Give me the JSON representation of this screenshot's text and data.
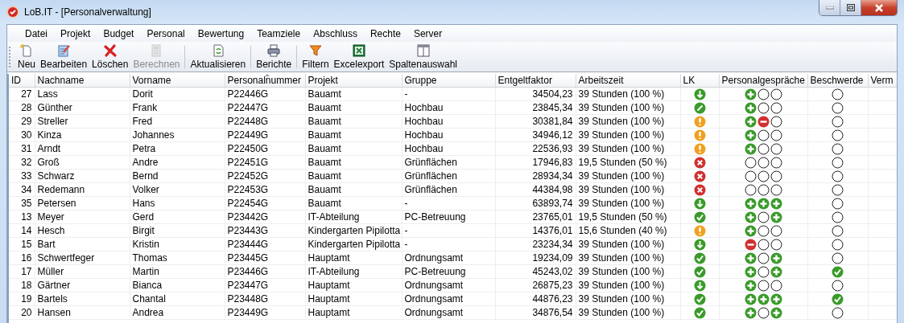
{
  "window": {
    "title": "LoB.IT - [Personalverwaltung]"
  },
  "menu": [
    "Datei",
    "Projekt",
    "Budget",
    "Personal",
    "Bewertung",
    "Teamziele",
    "Abschluss",
    "Rechte",
    "Server"
  ],
  "toolbar": [
    {
      "label": "Neu",
      "kind": "new",
      "disabled": false
    },
    {
      "label": "Bearbeiten",
      "kind": "edit",
      "disabled": false
    },
    {
      "label": "Löschen",
      "kind": "delete",
      "disabled": false
    },
    {
      "label": "Berechnen",
      "kind": "calc",
      "disabled": true
    },
    {
      "label": "Aktualisieren",
      "kind": "refresh",
      "disabled": false
    },
    {
      "label": "Berichte",
      "kind": "print",
      "disabled": false
    },
    {
      "label": "Filtern",
      "kind": "filter",
      "disabled": false
    },
    {
      "label": "Excelexport",
      "kind": "excel",
      "disabled": false
    },
    {
      "label": "Spaltenauswahl",
      "kind": "columns",
      "disabled": false
    }
  ],
  "table": {
    "columns": [
      {
        "label": "ID",
        "sorted": false
      },
      {
        "label": "Nachname",
        "sorted": false
      },
      {
        "label": "Vorname",
        "sorted": false
      },
      {
        "label": "Personalnummer",
        "sorted": true
      },
      {
        "label": "Projekt",
        "sorted": false
      },
      {
        "label": "Gruppe",
        "sorted": false
      },
      {
        "label": "Entgeltfaktor",
        "sorted": false
      },
      {
        "label": "Arbeitszeit",
        "sorted": false
      },
      {
        "label": "LK",
        "sorted": false
      },
      {
        "label": "Personalgespräche",
        "sorted": false
      },
      {
        "label": "Beschwerde",
        "sorted": false
      },
      {
        "label": "Verm",
        "sorted": false
      }
    ],
    "rows": [
      {
        "id": "27",
        "nachname": "Lass",
        "vorname": "Dorit",
        "personalnummer": "P22446G",
        "projekt": "Bauamt",
        "gruppe": "-",
        "entgeltfaktor": "34504,23",
        "arbeitszeit": "39 Stunden (100 %)",
        "lk": {
          "kind": "down"
        },
        "gespraeche": [
          {
            "kind": "plus"
          },
          {
            "kind": "empty"
          },
          {
            "kind": "empty"
          }
        ],
        "beschwerde": {
          "kind": "empty"
        }
      },
      {
        "id": "28",
        "nachname": "Günther",
        "vorname": "Frank",
        "personalnummer": "P22447G",
        "projekt": "Bauamt",
        "gruppe": "Hochbau",
        "entgeltfaktor": "23845,34",
        "arbeitszeit": "39 Stunden (100 %)",
        "lk": {
          "kind": "pencil"
        },
        "gespraeche": [
          {
            "kind": "plus"
          },
          {
            "kind": "empty"
          },
          {
            "kind": "empty"
          }
        ],
        "beschwerde": {
          "kind": "empty"
        }
      },
      {
        "id": "29",
        "nachname": "Streller",
        "vorname": "Fred",
        "personalnummer": "P22448G",
        "projekt": "Bauamt",
        "gruppe": "Hochbau",
        "entgeltfaktor": "30381,84",
        "arbeitszeit": "39 Stunden (100 %)",
        "lk": {
          "kind": "warn"
        },
        "gespraeche": [
          {
            "kind": "plus"
          },
          {
            "kind": "minus"
          },
          {
            "kind": "empty"
          }
        ],
        "beschwerde": {
          "kind": "empty"
        }
      },
      {
        "id": "30",
        "nachname": "Kinza",
        "vorname": "Johannes",
        "personalnummer": "P22449G",
        "projekt": "Bauamt",
        "gruppe": "Hochbau",
        "entgeltfaktor": "34946,12",
        "arbeitszeit": "39 Stunden (100 %)",
        "lk": {
          "kind": "warn"
        },
        "gespraeche": [
          {
            "kind": "plus"
          },
          {
            "kind": "empty"
          },
          {
            "kind": "empty"
          }
        ],
        "beschwerde": {
          "kind": "empty"
        }
      },
      {
        "id": "31",
        "nachname": "Arndt",
        "vorname": "Petra",
        "personalnummer": "P22450G",
        "projekt": "Bauamt",
        "gruppe": "Hochbau",
        "entgeltfaktor": "22536,93",
        "arbeitszeit": "39 Stunden (100 %)",
        "lk": {
          "kind": "warn"
        },
        "gespraeche": [
          {
            "kind": "plus"
          },
          {
            "kind": "empty"
          },
          {
            "kind": "empty"
          }
        ],
        "beschwerde": {
          "kind": "empty"
        }
      },
      {
        "id": "32",
        "nachname": "Groß",
        "vorname": "Andre",
        "personalnummer": "P22451G",
        "projekt": "Bauamt",
        "gruppe": "Grünflächen",
        "entgeltfaktor": "17946,83",
        "arbeitszeit": "19,5 Stunden (50 %)",
        "lk": {
          "kind": "error"
        },
        "gespraeche": [
          {
            "kind": "empty"
          },
          {
            "kind": "empty"
          },
          {
            "kind": "empty"
          }
        ],
        "beschwerde": {
          "kind": "empty"
        }
      },
      {
        "id": "33",
        "nachname": "Schwarz",
        "vorname": "Bernd",
        "personalnummer": "P22452G",
        "projekt": "Bauamt",
        "gruppe": "Grünflächen",
        "entgeltfaktor": "28934,34",
        "arbeitszeit": "39 Stunden (100 %)",
        "lk": {
          "kind": "error"
        },
        "gespraeche": [
          {
            "kind": "empty"
          },
          {
            "kind": "empty"
          },
          {
            "kind": "empty"
          }
        ],
        "beschwerde": {
          "kind": "empty"
        }
      },
      {
        "id": "34",
        "nachname": "Redemann",
        "vorname": "Volker",
        "personalnummer": "P22453G",
        "projekt": "Bauamt",
        "gruppe": "Grünflächen",
        "entgeltfaktor": "44384,98",
        "arbeitszeit": "39 Stunden (100 %)",
        "lk": {
          "kind": "error"
        },
        "gespraeche": [
          {
            "kind": "empty"
          },
          {
            "kind": "empty"
          },
          {
            "kind": "empty"
          }
        ],
        "beschwerde": {
          "kind": "empty"
        }
      },
      {
        "id": "35",
        "nachname": "Petersen",
        "vorname": "Hans",
        "personalnummer": "P22454G",
        "projekt": "Bauamt",
        "gruppe": "-",
        "entgeltfaktor": "63893,74",
        "arbeitszeit": "39 Stunden (100 %)",
        "lk": {
          "kind": "down"
        },
        "gespraeche": [
          {
            "kind": "plus"
          },
          {
            "kind": "plus"
          },
          {
            "kind": "plus"
          }
        ],
        "beschwerde": {
          "kind": "empty"
        }
      },
      {
        "id": "13",
        "nachname": "Meyer",
        "vorname": "Gerd",
        "personalnummer": "P23442G",
        "projekt": "IT-Abteilung",
        "gruppe": "PC-Betreuung",
        "entgeltfaktor": "23765,01",
        "arbeitszeit": "19,5 Stunden (50 %)",
        "lk": {
          "kind": "check"
        },
        "gespraeche": [
          {
            "kind": "plus"
          },
          {
            "kind": "empty"
          },
          {
            "kind": "plus"
          }
        ],
        "beschwerde": {
          "kind": "empty"
        }
      },
      {
        "id": "14",
        "nachname": "Hesch",
        "vorname": "Birgit",
        "personalnummer": "P23443G",
        "projekt": "Kindergarten Pipilotta",
        "gruppe": "-",
        "entgeltfaktor": "14376,01",
        "arbeitszeit": "15,6 Stunden (40 %)",
        "lk": {
          "kind": "warn"
        },
        "gespraeche": [
          {
            "kind": "plus"
          },
          {
            "kind": "empty"
          },
          {
            "kind": "empty"
          }
        ],
        "beschwerde": {
          "kind": "empty"
        }
      },
      {
        "id": "15",
        "nachname": "Bart",
        "vorname": "Kristin",
        "personalnummer": "P23444G",
        "projekt": "Kindergarten Pipilotta",
        "gruppe": "-",
        "entgeltfaktor": "23234,34",
        "arbeitszeit": "39 Stunden (100 %)",
        "lk": {
          "kind": "down"
        },
        "gespraeche": [
          {
            "kind": "minus"
          },
          {
            "kind": "empty"
          },
          {
            "kind": "empty"
          }
        ],
        "beschwerde": {
          "kind": "empty"
        }
      },
      {
        "id": "16",
        "nachname": "Schwertfeger",
        "vorname": "Thomas",
        "personalnummer": "P23445G",
        "projekt": "Hauptamt",
        "gruppe": "Ordnungsamt",
        "entgeltfaktor": "19234,09",
        "arbeitszeit": "39 Stunden (100 %)",
        "lk": {
          "kind": "check"
        },
        "gespraeche": [
          {
            "kind": "plus"
          },
          {
            "kind": "empty"
          },
          {
            "kind": "plus"
          }
        ],
        "beschwerde": {
          "kind": "empty"
        }
      },
      {
        "id": "17",
        "nachname": "Müller",
        "vorname": "Martin",
        "personalnummer": "P23446G",
        "projekt": "IT-Abteilung",
        "gruppe": "PC-Betreuung",
        "entgeltfaktor": "45243,02",
        "arbeitszeit": "39 Stunden (100 %)",
        "lk": {
          "kind": "check"
        },
        "gespraeche": [
          {
            "kind": "plus"
          },
          {
            "kind": "empty"
          },
          {
            "kind": "plus"
          }
        ],
        "beschwerde": {
          "kind": "check"
        }
      },
      {
        "id": "18",
        "nachname": "Gärtner",
        "vorname": "Bianca",
        "personalnummer": "P23447G",
        "projekt": "Hauptamt",
        "gruppe": "Ordnungsamt",
        "entgeltfaktor": "26875,23",
        "arbeitszeit": "39 Stunden (100 %)",
        "lk": {
          "kind": "down"
        },
        "gespraeche": [
          {
            "kind": "plus"
          },
          {
            "kind": "empty"
          },
          {
            "kind": "empty"
          }
        ],
        "beschwerde": {
          "kind": "empty"
        }
      },
      {
        "id": "19",
        "nachname": "Bartels",
        "vorname": "Chantal",
        "personalnummer": "P23448G",
        "projekt": "Hauptamt",
        "gruppe": "Ordnungsamt",
        "entgeltfaktor": "44876,23",
        "arbeitszeit": "39 Stunden (100 %)",
        "lk": {
          "kind": "check"
        },
        "gespraeche": [
          {
            "kind": "plus"
          },
          {
            "kind": "plus"
          },
          {
            "kind": "plus"
          }
        ],
        "beschwerde": {
          "kind": "check"
        }
      },
      {
        "id": "20",
        "nachname": "Hansen",
        "vorname": "Andrea",
        "personalnummer": "P23449G",
        "projekt": "Hauptamt",
        "gruppe": "Ordnungsamt",
        "entgeltfaktor": "34876,54",
        "arbeitszeit": "39 Stunden (100 %)",
        "lk": {
          "kind": "check"
        },
        "gespraeche": [
          {
            "kind": "plus"
          },
          {
            "kind": "empty"
          },
          {
            "kind": "plus"
          }
        ],
        "beschwerde": {
          "kind": "empty"
        }
      }
    ]
  }
}
